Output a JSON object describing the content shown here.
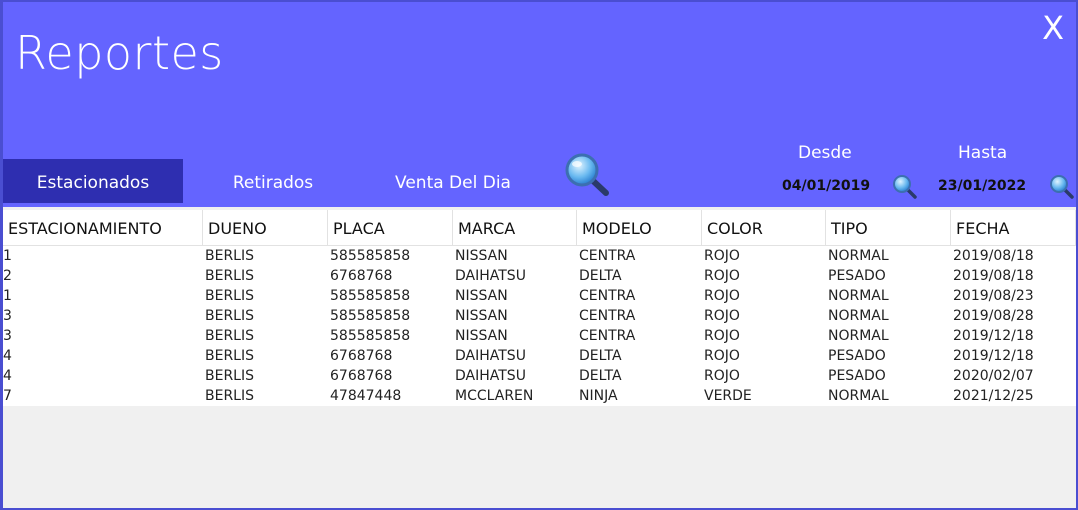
{
  "window": {
    "title": "Reportes",
    "close_label": "X"
  },
  "colors": {
    "header_bg": "#6464ff",
    "active_tab_bg": "#2e2eb0",
    "text_white": "#ffffff"
  },
  "tabs": [
    {
      "label": "Estacionados",
      "active": true
    },
    {
      "label": "Retirados",
      "active": false
    },
    {
      "label": "Venta Del Dia",
      "active": false
    }
  ],
  "icons": {
    "search": "search-icon"
  },
  "filters": {
    "desde": {
      "label": "Desde",
      "value": "04/01/2019"
    },
    "hasta": {
      "label": "Hasta",
      "value": "23/01/2022"
    }
  },
  "table": {
    "columns": [
      "ESTACIONAMIENTO",
      "DUENO",
      "PLACA",
      "MARCA",
      "MODELO",
      "COLOR",
      "TIPO",
      "FECHA"
    ],
    "rows": [
      [
        "1",
        "BERLIS",
        "585585858",
        "NISSAN",
        "CENTRA",
        "ROJO",
        "NORMAL",
        "2019/08/18"
      ],
      [
        "2",
        "BERLIS",
        "6768768",
        "DAIHATSU",
        "DELTA",
        "ROJO",
        "PESADO",
        "2019/08/18"
      ],
      [
        "1",
        "BERLIS",
        "585585858",
        "NISSAN",
        "CENTRA",
        "ROJO",
        "NORMAL",
        "2019/08/23"
      ],
      [
        "3",
        "BERLIS",
        "585585858",
        "NISSAN",
        "CENTRA",
        "ROJO",
        "NORMAL",
        "2019/08/28"
      ],
      [
        "3",
        "BERLIS",
        "585585858",
        "NISSAN",
        "CENTRA",
        "ROJO",
        "NORMAL",
        "2019/12/18"
      ],
      [
        "4",
        "BERLIS",
        "6768768",
        "DAIHATSU",
        "DELTA",
        "ROJO",
        "PESADO",
        "2019/12/18"
      ],
      [
        "4",
        "BERLIS",
        "6768768",
        "DAIHATSU",
        "DELTA",
        "ROJO",
        "PESADO",
        "2020/02/07"
      ],
      [
        "7",
        "BERLIS",
        "47847448",
        "MCCLAREN",
        "NINJA",
        "VERDE",
        "NORMAL",
        "2021/12/25"
      ]
    ]
  }
}
